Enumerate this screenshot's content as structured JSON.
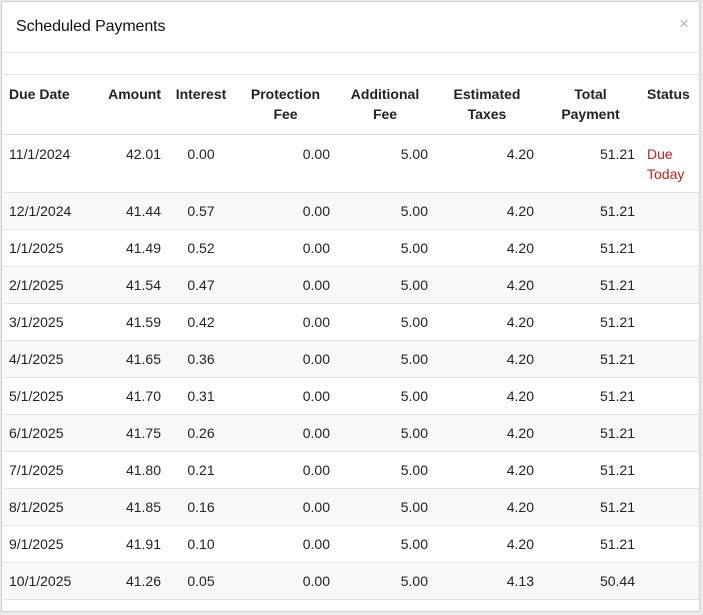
{
  "dialog": {
    "title": "Scheduled Payments",
    "close_glyph": "×"
  },
  "colors": {
    "status_due": "#c0201b",
    "row_stripe": "#f8f8f8"
  },
  "table": {
    "columns": [
      {
        "key": "due_date",
        "lines": [
          "Due Date"
        ]
      },
      {
        "key": "amount",
        "lines": [
          "Amount"
        ]
      },
      {
        "key": "interest",
        "lines": [
          "Interest"
        ]
      },
      {
        "key": "protection_fee",
        "lines": [
          "Protection",
          "Fee"
        ]
      },
      {
        "key": "additional_fee",
        "lines": [
          "Additional",
          "Fee"
        ]
      },
      {
        "key": "estimated_taxes",
        "lines": [
          "Estimated",
          "Taxes"
        ]
      },
      {
        "key": "total_payment",
        "lines": [
          "Total",
          "Payment"
        ]
      },
      {
        "key": "status",
        "lines": [
          "Status"
        ]
      }
    ],
    "rows": [
      {
        "due_date": "11/1/2024",
        "amount": "42.01",
        "interest": "0.00",
        "protection_fee": "0.00",
        "additional_fee": "5.00",
        "estimated_taxes": "4.20",
        "total_payment": "51.21",
        "status_lines": [
          "Due",
          "Today"
        ]
      },
      {
        "due_date": "12/1/2024",
        "amount": "41.44",
        "interest": "0.57",
        "protection_fee": "0.00",
        "additional_fee": "5.00",
        "estimated_taxes": "4.20",
        "total_payment": "51.21",
        "status_lines": []
      },
      {
        "due_date": "1/1/2025",
        "amount": "41.49",
        "interest": "0.52",
        "protection_fee": "0.00",
        "additional_fee": "5.00",
        "estimated_taxes": "4.20",
        "total_payment": "51.21",
        "status_lines": []
      },
      {
        "due_date": "2/1/2025",
        "amount": "41.54",
        "interest": "0.47",
        "protection_fee": "0.00",
        "additional_fee": "5.00",
        "estimated_taxes": "4.20",
        "total_payment": "51.21",
        "status_lines": []
      },
      {
        "due_date": "3/1/2025",
        "amount": "41.59",
        "interest": "0.42",
        "protection_fee": "0.00",
        "additional_fee": "5.00",
        "estimated_taxes": "4.20",
        "total_payment": "51.21",
        "status_lines": []
      },
      {
        "due_date": "4/1/2025",
        "amount": "41.65",
        "interest": "0.36",
        "protection_fee": "0.00",
        "additional_fee": "5.00",
        "estimated_taxes": "4.20",
        "total_payment": "51.21",
        "status_lines": []
      },
      {
        "due_date": "5/1/2025",
        "amount": "41.70",
        "interest": "0.31",
        "protection_fee": "0.00",
        "additional_fee": "5.00",
        "estimated_taxes": "4.20",
        "total_payment": "51.21",
        "status_lines": []
      },
      {
        "due_date": "6/1/2025",
        "amount": "41.75",
        "interest": "0.26",
        "protection_fee": "0.00",
        "additional_fee": "5.00",
        "estimated_taxes": "4.20",
        "total_payment": "51.21",
        "status_lines": []
      },
      {
        "due_date": "7/1/2025",
        "amount": "41.80",
        "interest": "0.21",
        "protection_fee": "0.00",
        "additional_fee": "5.00",
        "estimated_taxes": "4.20",
        "total_payment": "51.21",
        "status_lines": []
      },
      {
        "due_date": "8/1/2025",
        "amount": "41.85",
        "interest": "0.16",
        "protection_fee": "0.00",
        "additional_fee": "5.00",
        "estimated_taxes": "4.20",
        "total_payment": "51.21",
        "status_lines": []
      },
      {
        "due_date": "9/1/2025",
        "amount": "41.91",
        "interest": "0.10",
        "protection_fee": "0.00",
        "additional_fee": "5.00",
        "estimated_taxes": "4.20",
        "total_payment": "51.21",
        "status_lines": []
      },
      {
        "due_date": "10/1/2025",
        "amount": "41.26",
        "interest": "0.05",
        "protection_fee": "0.00",
        "additional_fee": "5.00",
        "estimated_taxes": "4.13",
        "total_payment": "50.44",
        "status_lines": []
      }
    ]
  }
}
